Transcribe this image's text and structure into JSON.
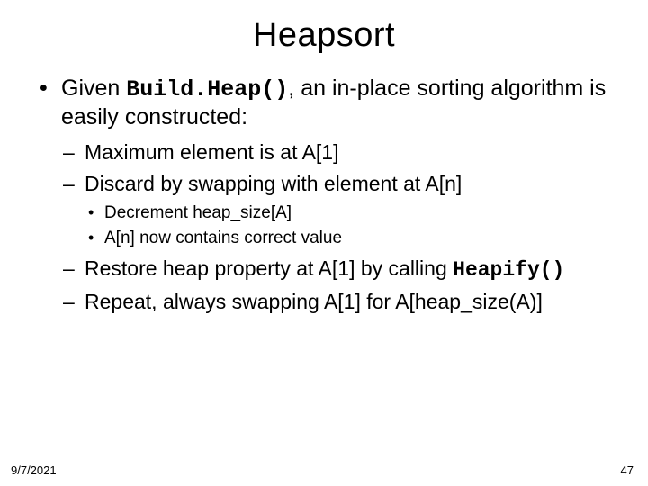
{
  "title": "Heapsort",
  "bullet1": {
    "pre": "Given ",
    "code": "Build.Heap()",
    "post": ",  an in-place sorting algorithm is easily constructed:"
  },
  "sub": {
    "s1": "Maximum element is at A[1]",
    "s2": "Discard by swapping with element at A[n]",
    "s2a": "Decrement heap_size[A]",
    "s2b": "A[n] now contains correct value",
    "s3_pre": "Restore heap property at A[1] by calling ",
    "s3_code": "Heapify()",
    "s4": "Repeat, always swapping A[1] for A[heap_size(A)]"
  },
  "footer": {
    "date": "9/7/2021",
    "page": "47"
  }
}
